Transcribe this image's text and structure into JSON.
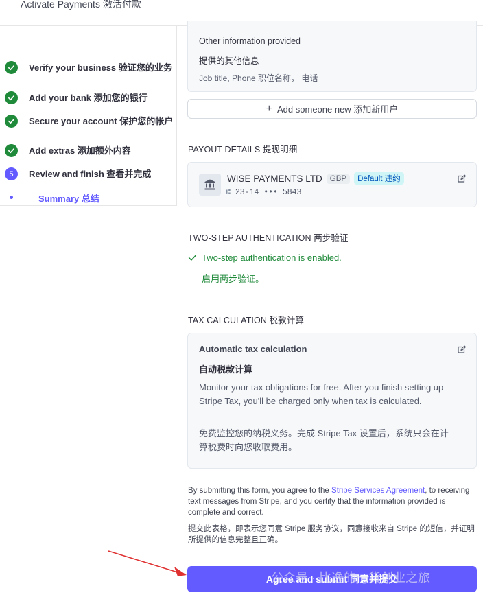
{
  "header": {
    "title": "Activate Payments 激活付款"
  },
  "sidebar": {
    "steps": [
      {
        "label": "Verify your business 验证您的业务",
        "status": "done"
      },
      {
        "label": "Add your bank 添加您的银行",
        "status": "done"
      },
      {
        "label": "Secure your account 保护您的帐户",
        "status": "done"
      },
      {
        "label": "Add extras 添加额外内容",
        "status": "done"
      },
      {
        "label": "Review and finish 查看并完成",
        "status": "current",
        "number": "5"
      }
    ],
    "sub_item": "Summary 总结"
  },
  "other_info": {
    "title": "Other information provided",
    "title_cn": "提供的其他信息",
    "fields": "Job title, Phone 职位名称， 电话"
  },
  "add_someone": {
    "label": "Add someone new 添加新用户"
  },
  "payout": {
    "section_title": "PAYOUT DETAILS 提现明细",
    "bank_name": "WISE PAYMENTS LTD",
    "currency": "GBP",
    "default_badge": "Default 违约",
    "account": "23-14 ••• 5843"
  },
  "two_step": {
    "section_title": "TWO-STEP AUTHENTICATION 两步验证",
    "status_en": "Two-step authentication is enabled.",
    "status_cn": "启用两步验证。"
  },
  "tax": {
    "section_title": "TAX CALCULATION 税款计算",
    "card_title": "Automatic tax calculation",
    "card_title_cn": "自动税款计算",
    "desc_en": "Monitor your tax obligations for free. After you finish setting up Stripe Tax, you'll be charged only when tax is calculated.",
    "desc_cn": "免费监控您的纳税义务。完成 Stripe Tax 设置后，系统只会在计算税费时向您收取费用。"
  },
  "agreement": {
    "text_before": "By submitting this form, you agree to the ",
    "link": "Stripe Services Agreement",
    "text_after": ", to receiving text messages from Stripe, and you certify that the information provided is complete and correct.",
    "text_cn": "提交此表格，即表示您同意 Stripe 服务协议，同意接收来自 Stripe 的短信，并证明所提供的信息完整且正确。"
  },
  "submit": {
    "label": "Agree and submit 同意并提交"
  },
  "watermark": {
    "text": "公众号 · 比逸的一货创业之旅"
  },
  "colors": {
    "accent": "#635bff",
    "success": "#1f8a3a"
  }
}
